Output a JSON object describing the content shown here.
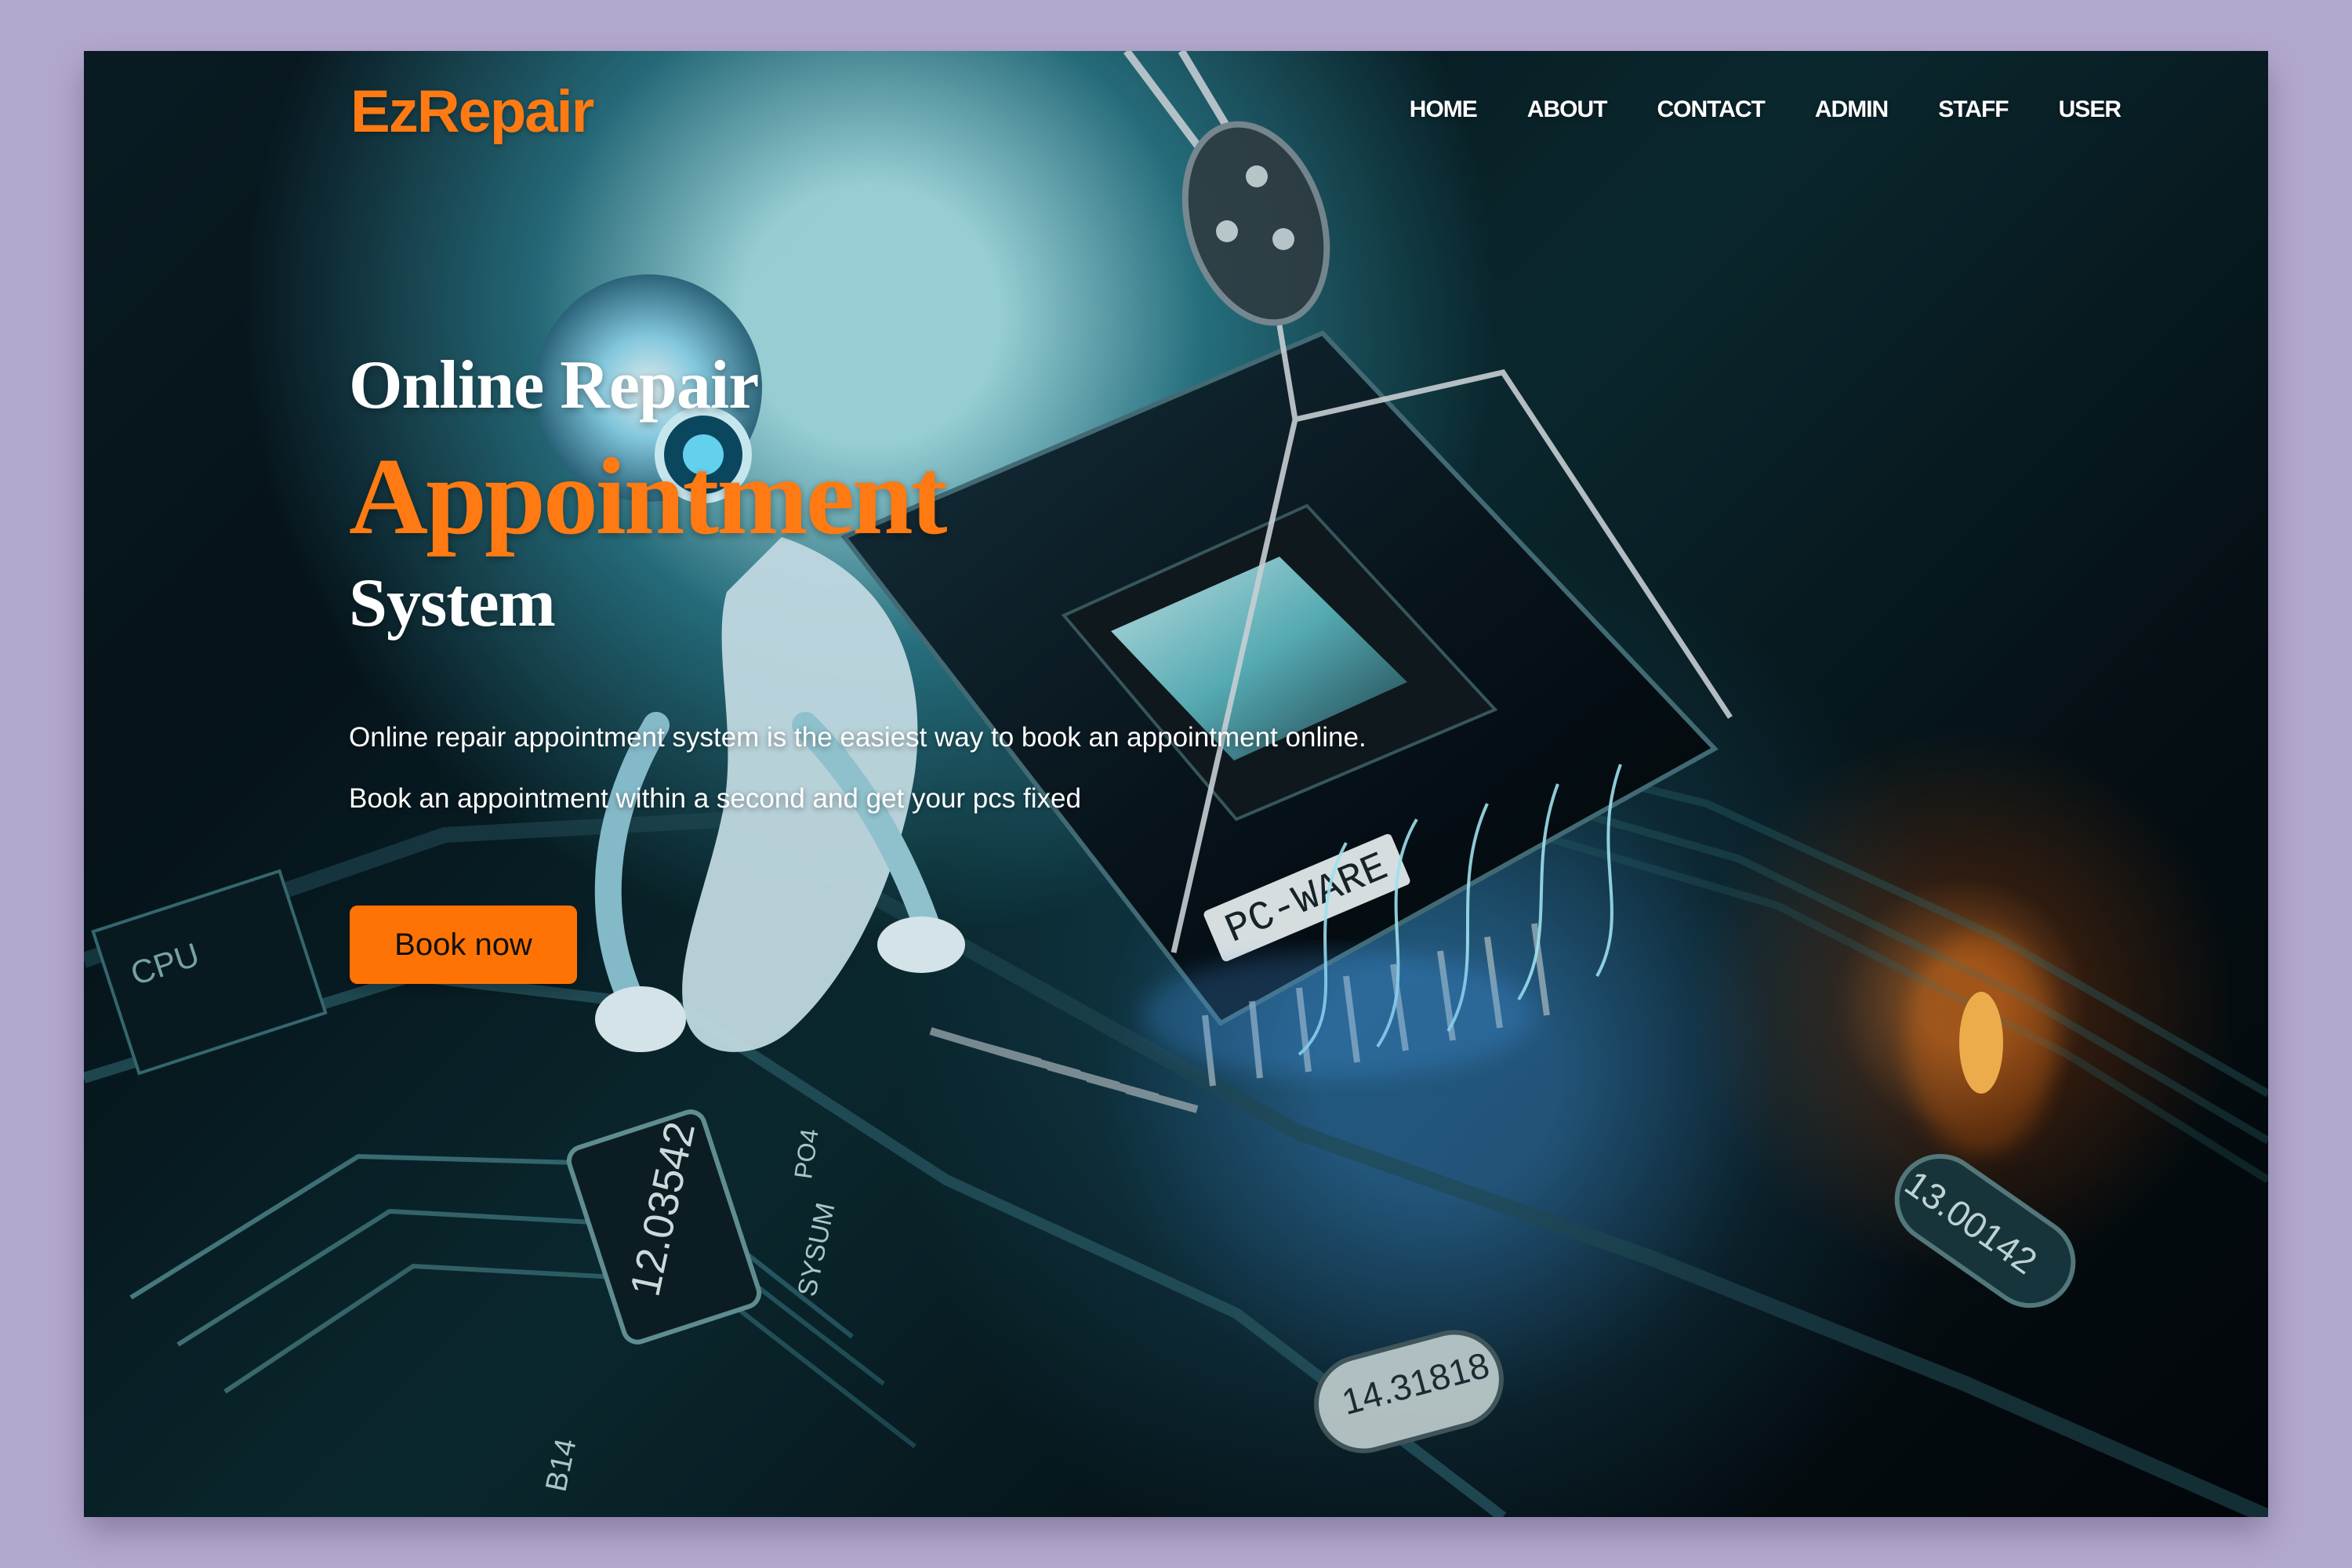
{
  "brand": {
    "name": "EzRepair"
  },
  "nav": {
    "items": [
      "HOME",
      "ABOUT",
      "CONTACT",
      "ADMIN",
      "STAFF",
      "USER"
    ]
  },
  "hero": {
    "line1": "Online Repair",
    "line2": "Appointment",
    "line3": "System",
    "desc1": "Online repair appointment system is the easiest way to book an appointment online.",
    "desc2": "Book an appointment within a second and get your pcs fixed",
    "button": "Book now"
  },
  "background": {
    "labels": [
      "PC-WARE",
      "12.03542",
      "14.31818",
      "13.00142",
      "CPU",
      "SYSUM",
      "PO4",
      "B14"
    ]
  },
  "colors": {
    "frame": "#b3a9cd",
    "accent": "#ff7a12",
    "button": "#ff7304",
    "text": "#ffffff"
  }
}
